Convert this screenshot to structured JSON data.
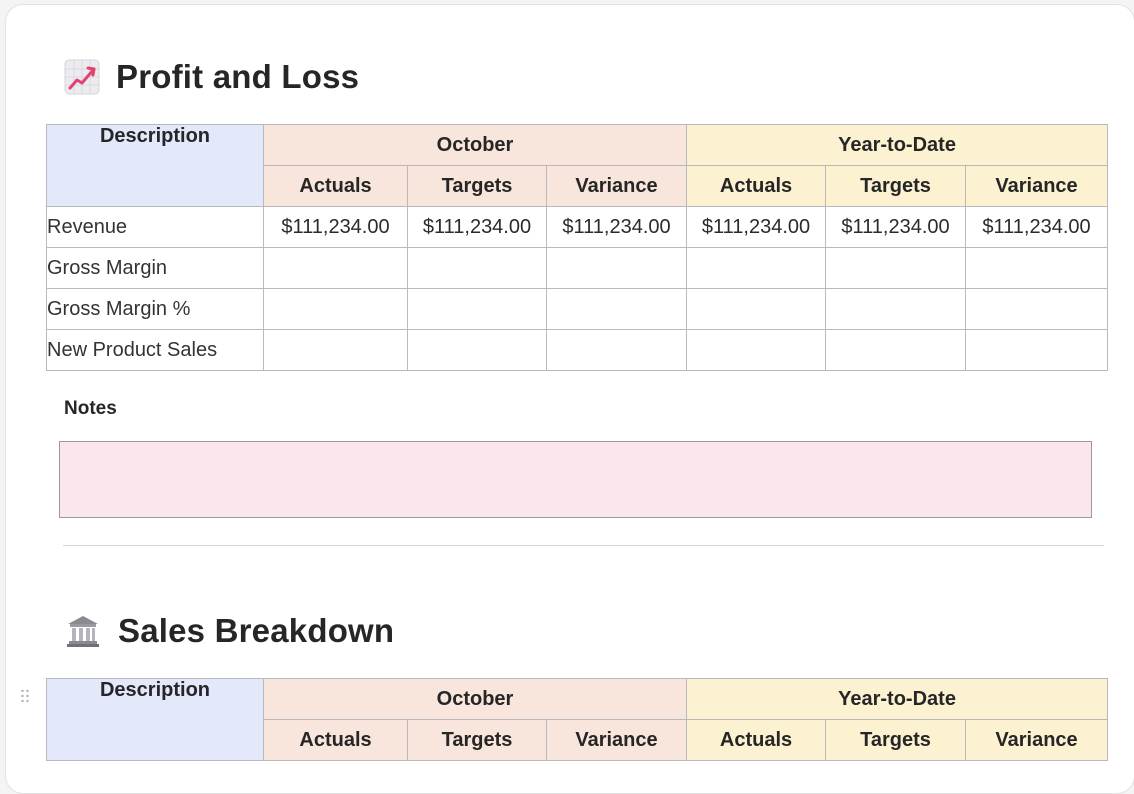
{
  "sections": [
    {
      "title": "Profit and Loss",
      "icon": "chart-increasing-icon",
      "table": {
        "description_header": "Description",
        "groups": [
          "October",
          "Year-to-Date"
        ],
        "subheaders": [
          "Actuals",
          "Targets",
          "Variance",
          "Actuals",
          "Targets",
          "Variance"
        ],
        "rows": [
          {
            "label": "Revenue",
            "values": [
              "$111,234.00",
              "$111,234.00",
              "$111,234.00",
              "$111,234.00",
              "$111,234.00",
              "$111,234.00"
            ]
          },
          {
            "label": "Gross Margin",
            "values": [
              "",
              "",
              "",
              "",
              "",
              ""
            ]
          },
          {
            "label": "Gross Margin %",
            "values": [
              "",
              "",
              "",
              "",
              "",
              ""
            ]
          },
          {
            "label": "New Product Sales",
            "values": [
              "",
              "",
              "",
              "",
              "",
              ""
            ]
          }
        ]
      },
      "notes_label": "Notes",
      "notes_value": ""
    },
    {
      "title": "Sales Breakdown",
      "icon": "bank-icon",
      "table": {
        "description_header": "Description",
        "groups": [
          "October",
          "Year-to-Date"
        ],
        "subheaders": [
          "Actuals",
          "Targets",
          "Variance",
          "Actuals",
          "Targets",
          "Variance"
        ]
      }
    }
  ],
  "colors": {
    "description_header_bg": "#e4e8fb",
    "october_header_bg": "#f8e6dc",
    "ytd_header_bg": "#fcf2d2",
    "notes_bg": "#fbe6ee"
  }
}
